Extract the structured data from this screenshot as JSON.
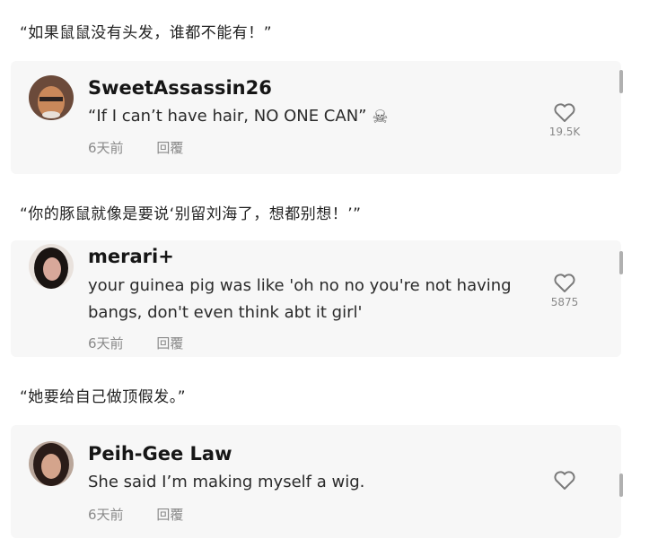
{
  "comments": [
    {
      "caption": "“如果鼠鼠没有头发，谁都不能有！”",
      "username": "SweetAssassin26",
      "text": "“If I can’t have hair, NO ONE CAN”",
      "emoji": "☠",
      "time": "6天前",
      "reply": "回覆",
      "likes": "19.5K",
      "avatar_colors": [
        "#3a2a22",
        "#c9885a"
      ]
    },
    {
      "caption": "“你的豚鼠就像是要说‘别留刘海了，想都别想！’”",
      "username": "merari+",
      "text_lines": [
        "your guinea pig was like 'oh no no you're not having",
        "bangs, don't even think abt it girl'"
      ],
      "time": "6天前",
      "reply": "回覆",
      "likes": "5875",
      "avatar_colors": [
        "#1a1412",
        "#d8a89a"
      ]
    },
    {
      "caption": "“她要给自己做顶假发。”",
      "username": "Peih-Gee Law",
      "text": "She said I’m making myself a wig.",
      "time": "6天前",
      "reply": "回覆",
      "likes": "",
      "avatar_colors": [
        "#2a1c18",
        "#d4a48c"
      ]
    }
  ],
  "icons": {
    "like": "heart-outline-icon",
    "emoji": "skull-crossbones-icon"
  }
}
